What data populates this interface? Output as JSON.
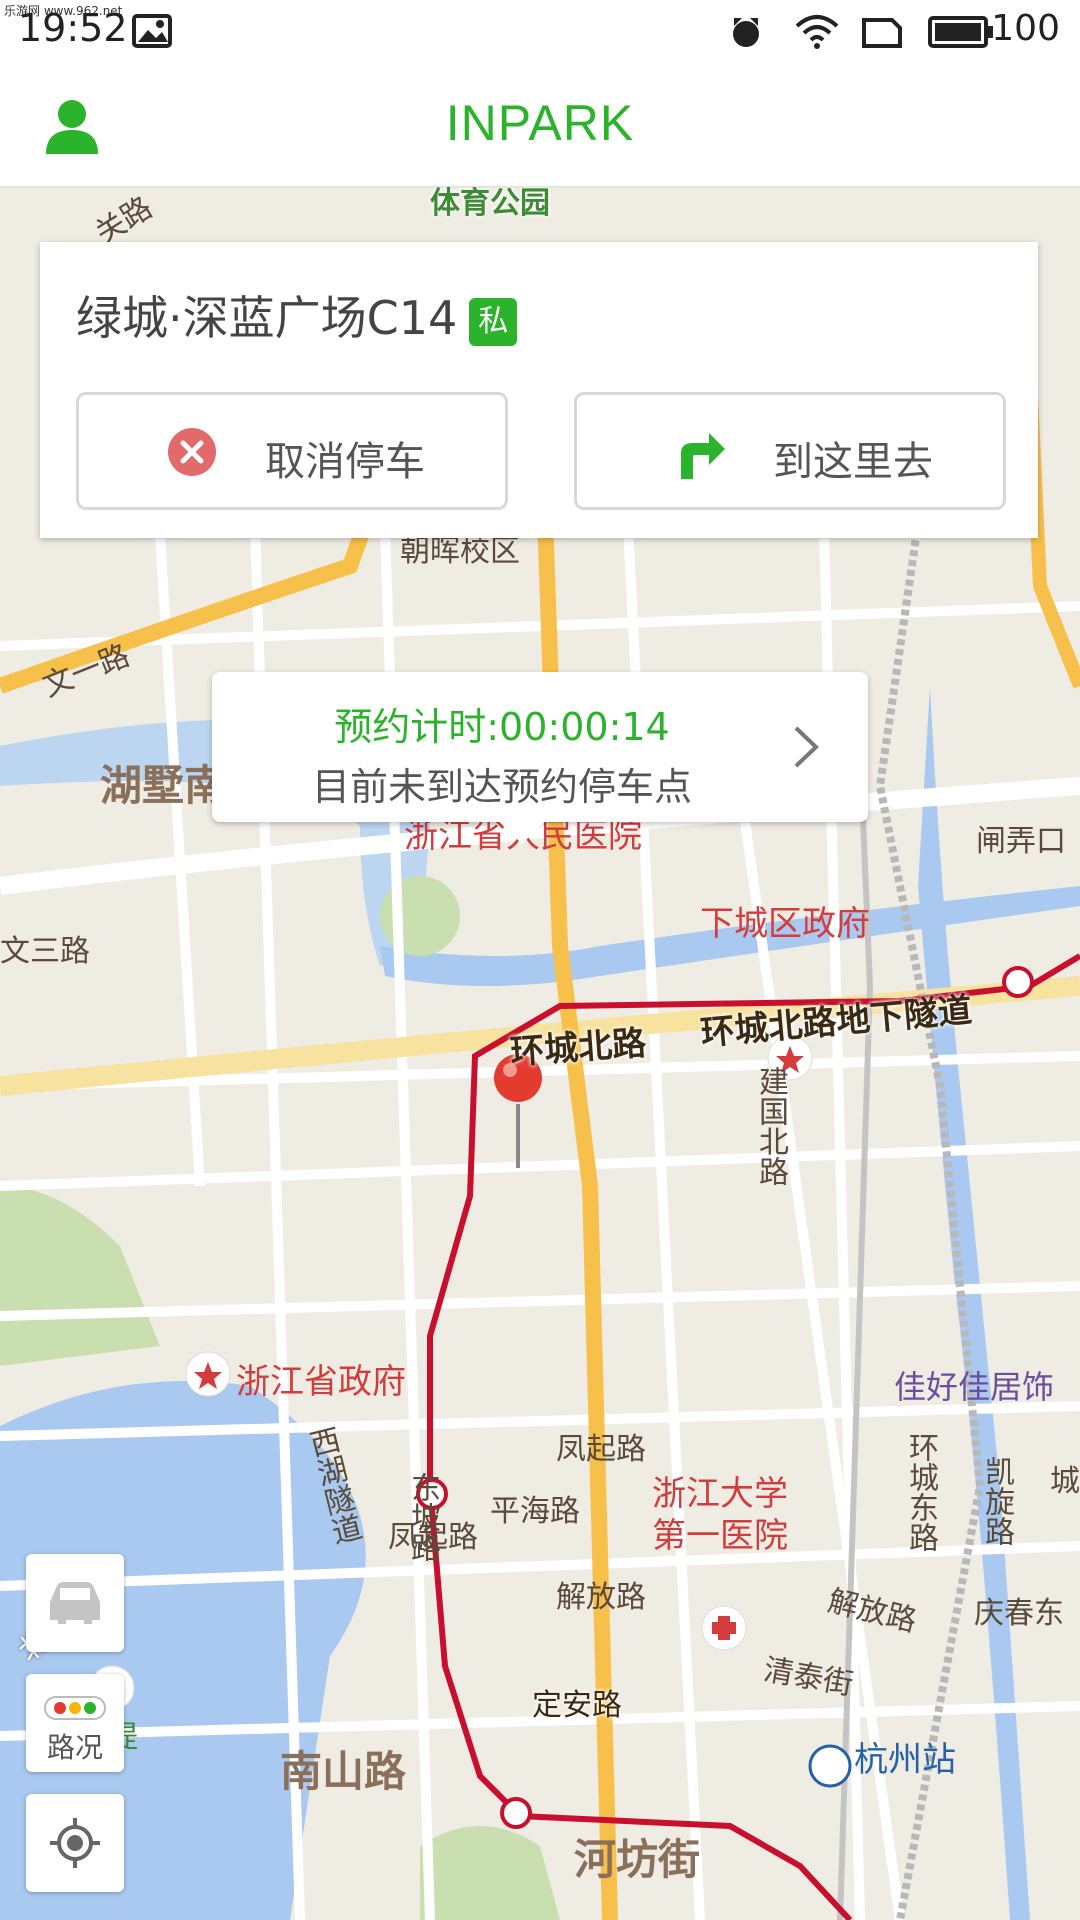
{
  "status_bar": {
    "time": "19:52",
    "watermark": "乐游网 www.962.net",
    "battery": "100"
  },
  "app_bar": {
    "title": "INPARK",
    "profile_icon": "person-icon"
  },
  "parking_card": {
    "place_name": "绿城·深蓝广场C14",
    "badge": "私",
    "cancel_label": "取消停车",
    "navigate_label": "到这里去"
  },
  "timer_popup": {
    "timer_text": "预约计时:00:00:14",
    "status_text": "目前未到达预约停车点"
  },
  "controls": {
    "car_icon": "car-icon",
    "traffic_label": "路况",
    "locate_icon": "locate-icon"
  },
  "map_labels": {
    "tiyu_park": "体育公园",
    "guan_road": "关路",
    "chaohui": "朝晖校区",
    "wenyi": "文一路",
    "wensan": "文三路",
    "hushu": "湖墅南",
    "hospital": "浙江省人民医院",
    "zhabeikou": "闸弄口",
    "xiacheng_gov": "下城区政府",
    "huancheng_n": "环城北路",
    "huancheng_tunnel": "环城北路地下隧道",
    "jianguo_n": "建国北路",
    "zhejiang_gov": "浙江省政府",
    "jiahao": "佳好佳居饰",
    "fengqi_road": "凤起路",
    "fengqi_station": "凤起路",
    "kaixuan": "凯旋路",
    "qingchun_e": "庆春东",
    "beishan": "北山街",
    "baidi": "白堤",
    "xihu_tunnel": "西湖隧道",
    "dongpo": "东坡路",
    "pinghai": "平海路",
    "zju_hospital_1": "浙江大学",
    "zju_hospital_2": "第一医院",
    "huancheng_e": "环城东路",
    "jiefang": "解放路",
    "jiefang2": "解放路",
    "qingtai": "清泰街",
    "dingan": "定安路",
    "hangzhou_station": "杭州站",
    "nanshan": "南山路",
    "hefang": "河坊街",
    "cheng": "城"
  },
  "colors": {
    "brand_green": "#2bb32b",
    "metro_red": "#c8102e",
    "highway_yellow": "#f7c04a",
    "water": "#a9c9f0"
  }
}
